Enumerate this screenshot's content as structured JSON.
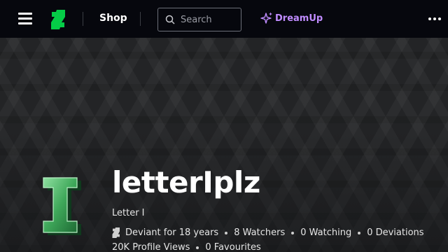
{
  "nav": {
    "shop_label": "Shop",
    "search_placeholder": "Search",
    "dreamup_label": "DreamUp",
    "brand_color": "#05cc47",
    "dreamup_color": "#c08cff"
  },
  "profile": {
    "username": "letterIplz",
    "tagline": "Letter I",
    "avatar_letter": "I",
    "stats": {
      "deviant_for": "Deviant for 18 years",
      "watchers": "8 Watchers",
      "watching": "0 Watching",
      "deviations": "0 Deviations",
      "profile_views": "20K Profile Views",
      "favourites": "0 Favourites"
    }
  },
  "icons": [
    "menu-icon",
    "deviantart-logo-icon",
    "search-icon",
    "sparkle-icon",
    "more-icon",
    "deviant-icon"
  ]
}
